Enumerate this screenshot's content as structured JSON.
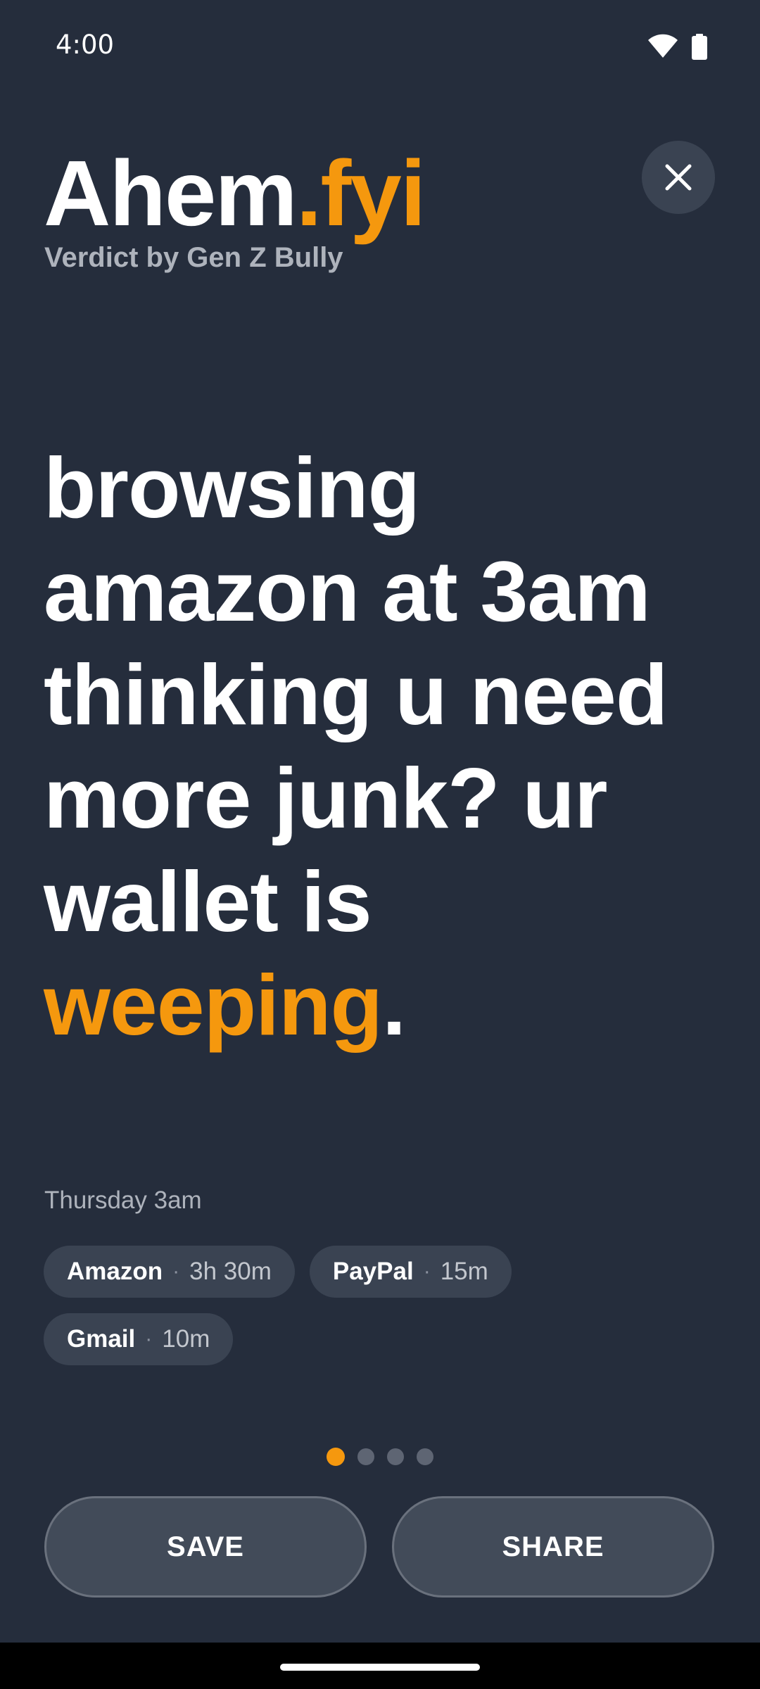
{
  "status_bar": {
    "time": "4:00"
  },
  "header": {
    "brand_main": "Ahem",
    "brand_accent": ".fyi",
    "tagline": "Verdict by Gen Z Bully"
  },
  "verdict": {
    "text_main": "browsing amazon at 3am thinking u need more junk? ur wallet is ",
    "text_accent": "weeping",
    "text_end": "."
  },
  "session": {
    "time_label": "Thursday 3am",
    "apps": [
      {
        "name": "Amazon",
        "separator": "·",
        "duration": "3h 30m"
      },
      {
        "name": "PayPal",
        "separator": "·",
        "duration": "15m"
      },
      {
        "name": "Gmail",
        "separator": "·",
        "duration": "10m"
      }
    ]
  },
  "pager": {
    "total": 4,
    "active": 1
  },
  "actions": {
    "save_label": "SAVE",
    "share_label": "SHARE"
  },
  "colors": {
    "background": "#252D3C",
    "accent": "#F5980E",
    "chip": "#3A4352",
    "button": "#424B59"
  },
  "icons": {
    "close": "close-icon",
    "wifi": "wifi-icon",
    "battery": "battery-icon"
  }
}
